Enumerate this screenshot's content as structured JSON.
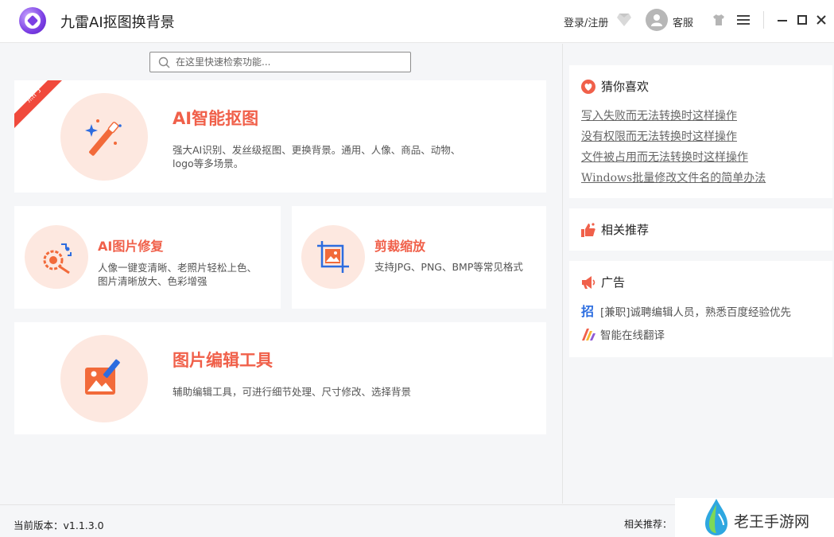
{
  "app": {
    "title": "九雷AI抠图换背景"
  },
  "header": {
    "login_label": "登录/注册",
    "service_label": "客服"
  },
  "search": {
    "placeholder": "在这里快速检索功能..."
  },
  "tools": [
    {
      "title": "AI智能抠图",
      "desc_line1": "强大AI识别、发丝级抠图、更换背景。通用、人像、商品、动物、",
      "desc_line2": "logo等多场景。",
      "badge": "热门"
    },
    {
      "title": "AI图片修复",
      "desc_line1": "人像一键变清晰、老照片轻松上色、",
      "desc_line2": "图片清晰放大、色彩增强"
    },
    {
      "title": "剪裁缩放",
      "desc_line1": "支持JPG、PNG、BMP等常见格式"
    },
    {
      "title": "图片编辑工具",
      "desc_line1": "辅助编辑工具，可进行细节处理、尺寸修改、选择背景"
    }
  ],
  "sidebar": {
    "guess": {
      "title": "猜你喜欢",
      "links": [
        "写入失败而无法转换时这样操作",
        "没有权限而无法转换时这样操作",
        "文件被占用而无法转换时这样操作",
        "Windows批量修改文件名的简单办法"
      ]
    },
    "related": {
      "title": "相关推荐"
    },
    "ads": {
      "title": "广告",
      "items": [
        "[兼职]诚聘编辑人员，熟悉百度经验优先",
        "智能在线翻译"
      ]
    }
  },
  "footer": {
    "version_label": "当前版本：v1.1.3.0",
    "related_label": "相关推荐："
  },
  "watermark": {
    "text": "老王手游网"
  },
  "colors": {
    "accent": "#f0604a",
    "icon_bg": "#fde8e0",
    "ribbon": "#f04a3c",
    "ad_blue": "#2b6de0"
  }
}
